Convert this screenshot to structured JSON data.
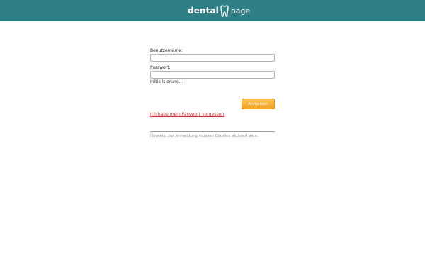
{
  "header": {
    "logo_text_primary": "dental",
    "logo_text_secondary": "page",
    "logo_icon": "tooth-icon",
    "background_color": "#2f7f86"
  },
  "login": {
    "username_label": "Benutzername:",
    "username_value": "",
    "password_label": "Passwort:",
    "password_value": "",
    "status_text": "Initialisierung...",
    "submit_label": "Anmelden",
    "submit_color": "#f5a623",
    "forgot_link": "Ich habe mein Passwort vergessen",
    "forgot_link_color": "#c0392b",
    "cookie_hint": "Hinweis: zur Anmeldung müssen Cookies aktiviert sein."
  }
}
